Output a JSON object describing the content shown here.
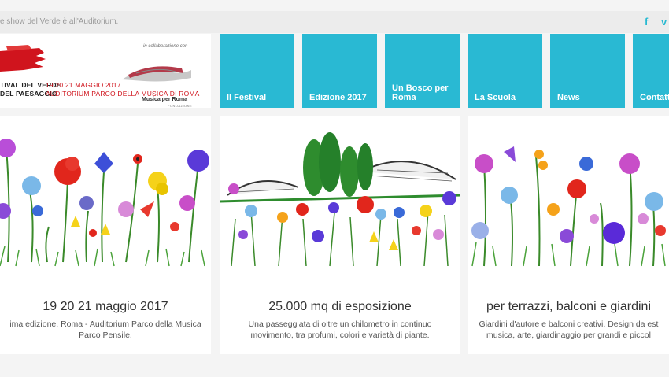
{
  "topbar": {
    "tagline": "e show del Verde è all'Auditorium.",
    "social": [
      {
        "icon": "facebook-icon",
        "glyph": "f"
      },
      {
        "icon": "vimeo-icon",
        "glyph": "v"
      }
    ]
  },
  "logo": {
    "name_lines": "TIVAL DEL VERDE\nDEL PAESAGGIO",
    "date_lines": "19 20 21 MAGGIO 2017\nAUDITORIUM PARCO DELLA MUSICA DI ROMA",
    "collab_text": "in collaborazione con",
    "partner_name": "Musica per Roma",
    "partner_sub": "FONDAZIONE",
    "colors": {
      "red": "#d0141d",
      "accent": "#29b9d3"
    }
  },
  "nav": {
    "items": [
      {
        "label": "Il Festival"
      },
      {
        "label": "Edizione 2017"
      },
      {
        "label": "Un Bosco per Roma"
      },
      {
        "label": "La Scuola"
      },
      {
        "label": "News"
      },
      {
        "label": "Contatti"
      }
    ]
  },
  "cards": [
    {
      "title": "19 20 21 maggio 2017",
      "text_line1": "ima edizione. Roma - Auditorium Parco della Musica",
      "text_line2": "Parco Pensile."
    },
    {
      "title": "25.000 mq di esposizione",
      "text_line1": "Una passeggiata di oltre un chilometro in continuo",
      "text_line2": "movimento, tra profumi, colori e varietà di piante."
    },
    {
      "title": "per terrazzi, balconi e giardini",
      "text_line1": "Giardini d'autore e balconi creativi. Design da est",
      "text_line2": "musica, arte, giardinaggio per grandi e piccol"
    }
  ]
}
